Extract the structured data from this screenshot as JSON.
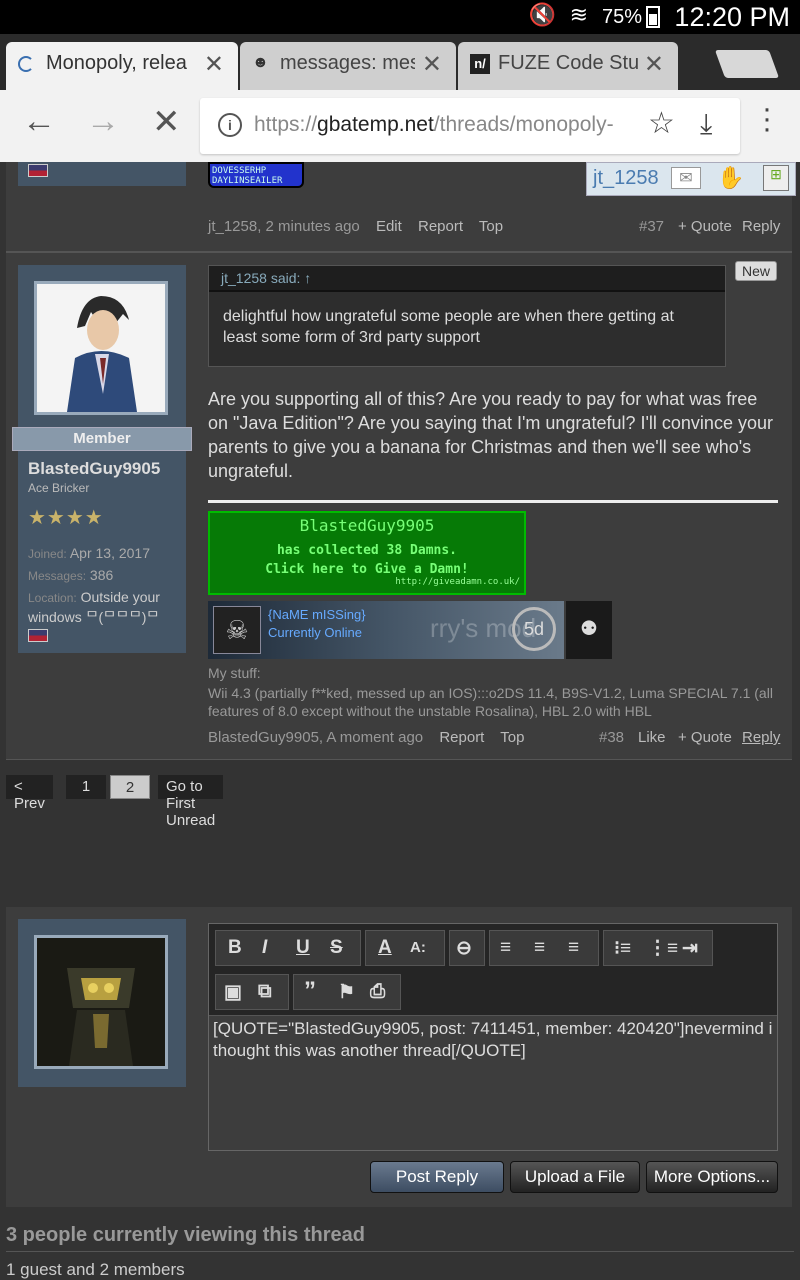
{
  "status_bar": {
    "time": "12:20 PM",
    "battery": "75%",
    "icons": [
      "mute-icon",
      "wifi-icon",
      "battery-icon"
    ]
  },
  "tabs": [
    {
      "label": "Monopoly, relea",
      "icon": "loading-spinner-icon",
      "active": true
    },
    {
      "label": "messages: mes",
      "icon": "reddit-icon",
      "active": false
    },
    {
      "label": "FUZE Code Stud",
      "icon": "fuze-icon",
      "active": false
    }
  ],
  "omnibar": {
    "url_prefix": "https://",
    "url_domain": "gbatemp.net",
    "url_path": "/threads/monopoly-"
  },
  "post37": {
    "badge_text": "DOVESSERHP DAYLINSEAILER",
    "sig_user": "jt_1258",
    "meta": {
      "author_time": "jt_1258, 2 minutes ago",
      "edit": "Edit",
      "report": "Report",
      "top": "Top",
      "num": "#37",
      "quote": "+ Quote",
      "reply": "Reply"
    }
  },
  "post38": {
    "new_badge": "New",
    "quote_header": "jt_1258 said: ↑",
    "quote_text": "delightful how ungrateful some people are when there getting at least some form of 3rd party support",
    "body": "Are you supporting all of this? Are you ready to pay for what was free on \"Java Edition\"? Are you saying that I'm ungrateful? I'll convince your parents to give you a banana for Christmas and then we'll see who's ungrateful.",
    "user": {
      "rank": "Member",
      "name": "BlastedGuy9905",
      "title": "Ace Bricker",
      "joined_label": "Joined:",
      "joined": "Apr 13, 2017",
      "messages_label": "Messages:",
      "messages": "386",
      "location_label": "Location:",
      "location": "Outside your windows ᄆ(ᄆᄆᄆ)ᄆ"
    },
    "damn_banner": {
      "line1": "BlastedGuy9905",
      "line2": "has collected 38 Damns.",
      "line3": "Click here to Give a Damn!",
      "url": "http://giveadamn.co.uk/"
    },
    "online_banner": {
      "name": "{NaME mISSing}",
      "status": "Currently Online",
      "bg_text": "rry's mod",
      "badge": "5d"
    },
    "stuff_label": "My stuff:",
    "stuff_text": "Wii 4.3 (partially f**ked, messed up an IOS):::o2DS 11.4, B9S-V1.2, Luma SPECIAL 7.1 (all features of 8.0 except without the unstable Rosalina), HBL 2.0 with HBL",
    "meta": {
      "author_time": "BlastedGuy9905, A moment ago",
      "report": "Report",
      "top": "Top",
      "num": "#38",
      "like": "Like",
      "quote": "+ Quote",
      "reply": "Reply"
    }
  },
  "pagination": {
    "prev": "< Prev",
    "p1": "1",
    "p2": "2",
    "first_unread": "Go to First Unread"
  },
  "editor": {
    "text": "[QUOTE=\"BlastedGuy9905, post: 7411451, member: 420420\"]nevermind i thought this was another thread[/QUOTE]",
    "post_reply": "Post Reply",
    "upload": "Upload a File",
    "more": "More Options..."
  },
  "viewers": {
    "title": "3 people currently viewing this thread",
    "detail": "1 guest and 2 members"
  }
}
